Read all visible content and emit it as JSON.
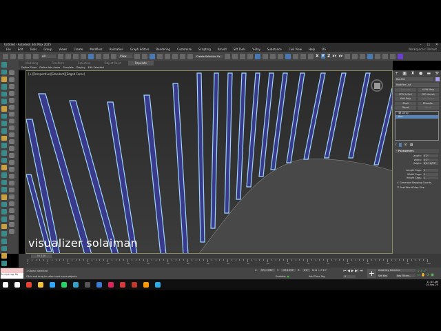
{
  "window": {
    "title": "Untitled - Autodesk 3ds Max 2025",
    "controls": [
      "–",
      "◻",
      "✕"
    ]
  },
  "menu": [
    "File",
    "Edit",
    "Tools",
    "Group",
    "Views",
    "Create",
    "Modifiers",
    "Animation",
    "Graph Editors",
    "Rendering",
    "Customize",
    "Scripting",
    "Arnold",
    "Sift Tools",
    "V-Ray",
    "Substance",
    "Civil View",
    "Help",
    "OS"
  ],
  "workspace": "Workspaces: Default",
  "toolbar": {
    "selection_filter": "All",
    "view": "View",
    "named_selection": "Create Selection Se",
    "axis": [
      "X",
      "Y",
      "Z",
      "XY",
      "XY"
    ],
    "active_axis": "Y"
  },
  "ribbon": {
    "tabs": [
      "Modeling",
      "Freeform",
      "Selection",
      "Object Paint",
      "Populate"
    ],
    "active": "Populate",
    "tools": [
      "Define Flows",
      "Define Idle Areas",
      "Simulate",
      "Display",
      "Edit Selected"
    ]
  },
  "viewport": {
    "label": "[+][Perspective][Standard][Edged Faces]",
    "watermark": "visualizer solaiman",
    "pillar_color": "#3a3a8c",
    "outline_color": "#9fd8ff"
  },
  "command_panel": {
    "object_name": "Box001",
    "modifier_list": "Modifier List",
    "buttons": [
      "Extrude",
      "UVW Map",
      "FFD 2x2x2",
      "FFD 4x4x4",
      "Edit Poly",
      "Edit Spline",
      "Shell",
      "Chamfer",
      "Bend",
      "Bevel"
    ],
    "dim_buttons": [
      "Extrude",
      "Edit Spline",
      "Bevel"
    ],
    "stack": [
      "Array",
      "Box"
    ],
    "selected_stack": "Box",
    "rollout": "Parameters",
    "params": [
      {
        "label": "Length:",
        "value": "0'2\""
      },
      {
        "label": "Width:",
        "value": "0'2\""
      },
      {
        "label": "Height:",
        "value": "8'6 16/32\""
      },
      {
        "label": "Length Segs:",
        "value": "1"
      },
      {
        "label": "Width Segs:",
        "value": "1"
      },
      {
        "label": "Height Segs:",
        "value": "1"
      }
    ],
    "checkboxes": [
      {
        "label": "Generate Mapping Coords.",
        "checked": true
      },
      {
        "label": "Real-World Map Size",
        "checked": false
      }
    ]
  },
  "timeline": {
    "frame": "0 / 100",
    "ticks": [
      "0",
      "5",
      "10",
      "15",
      "20",
      "25",
      "30",
      "35",
      "40",
      "45",
      "50",
      "55",
      "60",
      "65",
      "70",
      "75",
      "80",
      "85",
      "90",
      "95",
      "100"
    ]
  },
  "status": {
    "maxscript": "Scripting Ms",
    "selected": "1 Object Selected",
    "prompt": "Click and drag to select and move objects",
    "x": "371.2332\"",
    "y": "-93.1332\"",
    "z": "0'0\"",
    "grid": "Grid = 0'10\"",
    "enabled": "Enabled:",
    "add_time_tag": "Add Time Tag",
    "frame_field": "0",
    "auto_key": "Auto Key",
    "set_key": "Set Key",
    "key_mode": "Selected",
    "key_filters": "Key Filters..."
  },
  "taskbar": {
    "time": "11:44 AM",
    "date": "24-Sep-25",
    "icons": [
      {
        "name": "windows-start",
        "color": "#ffffff"
      },
      {
        "name": "search",
        "color": "#ffffff"
      },
      {
        "name": "chrome",
        "color": "#e94235"
      },
      {
        "name": "file-explorer",
        "color": "#f3c13a"
      },
      {
        "name": "photoshop",
        "color": "#31a8ff"
      },
      {
        "name": "whatsapp",
        "color": "#25d366"
      },
      {
        "name": "3ds-max",
        "color": "#37a0c8"
      },
      {
        "name": "app-dark",
        "color": "#555555"
      },
      {
        "name": "app-blue",
        "color": "#3a7bd5"
      },
      {
        "name": "app-pink",
        "color": "#e0245e"
      },
      {
        "name": "app-red",
        "color": "#d43b3b"
      },
      {
        "name": "app-record",
        "color": "#c0392b"
      },
      {
        "name": "illustrator",
        "color": "#ff9a00"
      },
      {
        "name": "telegram",
        "color": "#2aabee"
      }
    ]
  }
}
